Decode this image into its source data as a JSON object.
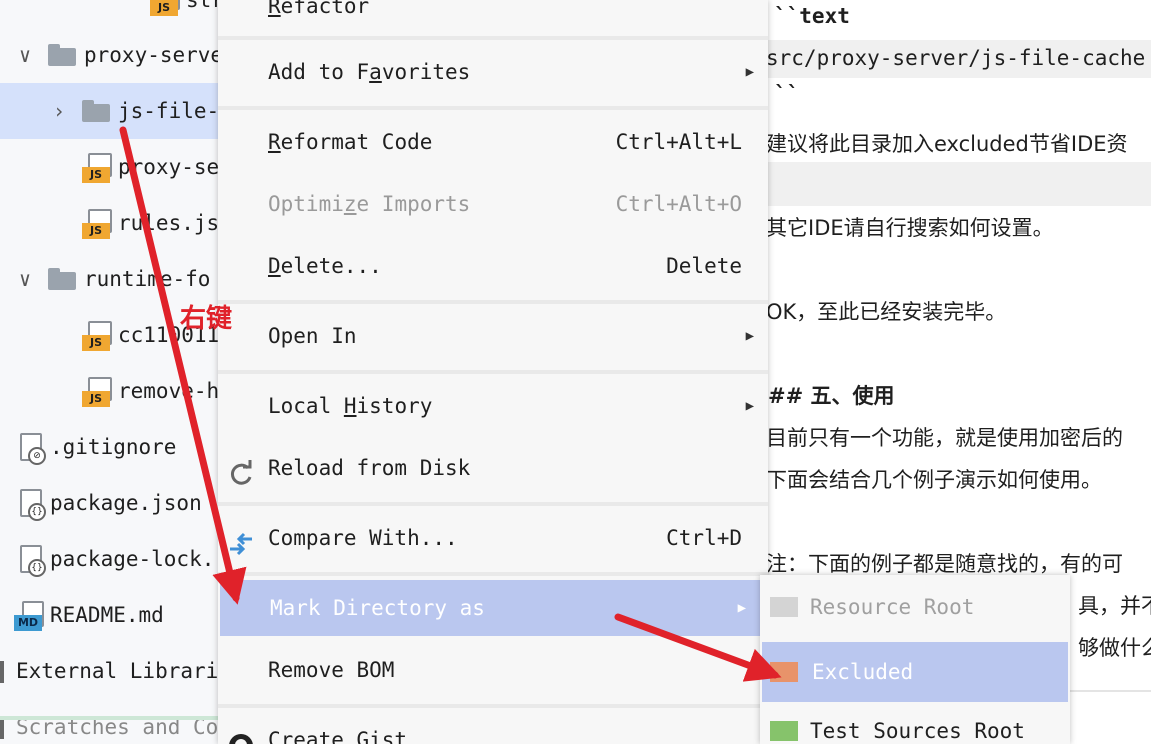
{
  "tree": {
    "items": [
      {
        "label": "str",
        "kind": "js",
        "indent": 3
      },
      {
        "label": "proxy-serve",
        "kind": "folder-open",
        "indent": 1
      },
      {
        "label": "js-file-",
        "kind": "folder-closed",
        "indent": 2,
        "selected": true
      },
      {
        "label": "proxy-se",
        "kind": "js",
        "indent": 2
      },
      {
        "label": "rules.js",
        "kind": "js",
        "indent": 2
      },
      {
        "label": "runtime-fo",
        "kind": "folder-open",
        "indent": 1
      },
      {
        "label": "cc110011",
        "kind": "js",
        "indent": 2
      },
      {
        "label": "remove-h",
        "kind": "js",
        "indent": 2
      },
      {
        "label": ".gitignore",
        "kind": "gitignore",
        "indent": 0
      },
      {
        "label": "package.json",
        "kind": "json",
        "indent": 0
      },
      {
        "label": "package-lock.",
        "kind": "json",
        "indent": 0
      },
      {
        "label": "README.md",
        "kind": "md",
        "indent": 0
      },
      {
        "label": "External Librari",
        "kind": "lib",
        "indent": -1
      },
      {
        "label": "Scratches and Co",
        "kind": "scratch",
        "indent": -1
      }
    ]
  },
  "menu": {
    "items": [
      {
        "label": "Refactor",
        "mnemonic": "R"
      },
      {
        "label": "Add to Favorites",
        "mnemonic": "a",
        "submenu": true
      },
      {
        "label": "Reformat Code",
        "mnemonic": "R",
        "shortcut": "Ctrl+Alt+L"
      },
      {
        "label": "Optimize Imports",
        "mnemonic": "z",
        "shortcut": "Ctrl+Alt+O",
        "disabled": true
      },
      {
        "label": "Delete...",
        "mnemonic": "D",
        "shortcut": "Delete"
      },
      {
        "label": "Open In",
        "submenu": true
      },
      {
        "label": "Local History",
        "mnemonic": "H",
        "submenu": true
      },
      {
        "label": "Reload from Disk",
        "icon": "reload-icon"
      },
      {
        "label": "Compare With...",
        "icon": "compare-icon",
        "shortcut": "Ctrl+D"
      },
      {
        "label": "Mark Directory as",
        "submenu": true,
        "active": true
      },
      {
        "label": "Remove BOM"
      },
      {
        "label": "Create Gist",
        "icon": "github-icon"
      }
    ]
  },
  "submenu": {
    "items": [
      {
        "label": "Resource Root",
        "disabled": true,
        "color": "#d4d4d4"
      },
      {
        "label": "Excluded",
        "active": true,
        "color": "#e8936a"
      },
      {
        "label": "Test Sources Root",
        "color": "#86c36b"
      }
    ]
  },
  "editor": {
    "lines": [
      {
        "text": "``text",
        "bold": true
      },
      {
        "text": "src/proxy-server/js-file-cache",
        "code": true
      },
      {
        "text": "``",
        "bold": true
      },
      {
        "text": "建议将此目录加入excluded节省IDE资"
      },
      {
        "text": ""
      },
      {
        "text": "其它IDE请自行搜索如何设置。"
      },
      {
        "text": "OK，至此已经安装完毕。"
      },
      {
        "text": "## 五、使用",
        "bold": true
      },
      {
        "text": "目前只有一个功能，就是使用加密后的"
      },
      {
        "text": "下面会结合几个例子演示如何使用。"
      },
      {
        "text": "注：下面的例子都是随意找的，有的可"
      },
      {
        "text": "具，并不"
      },
      {
        "text": "够做什么"
      }
    ]
  },
  "annotation": {
    "label": "右键",
    "color": "#e0222a"
  }
}
